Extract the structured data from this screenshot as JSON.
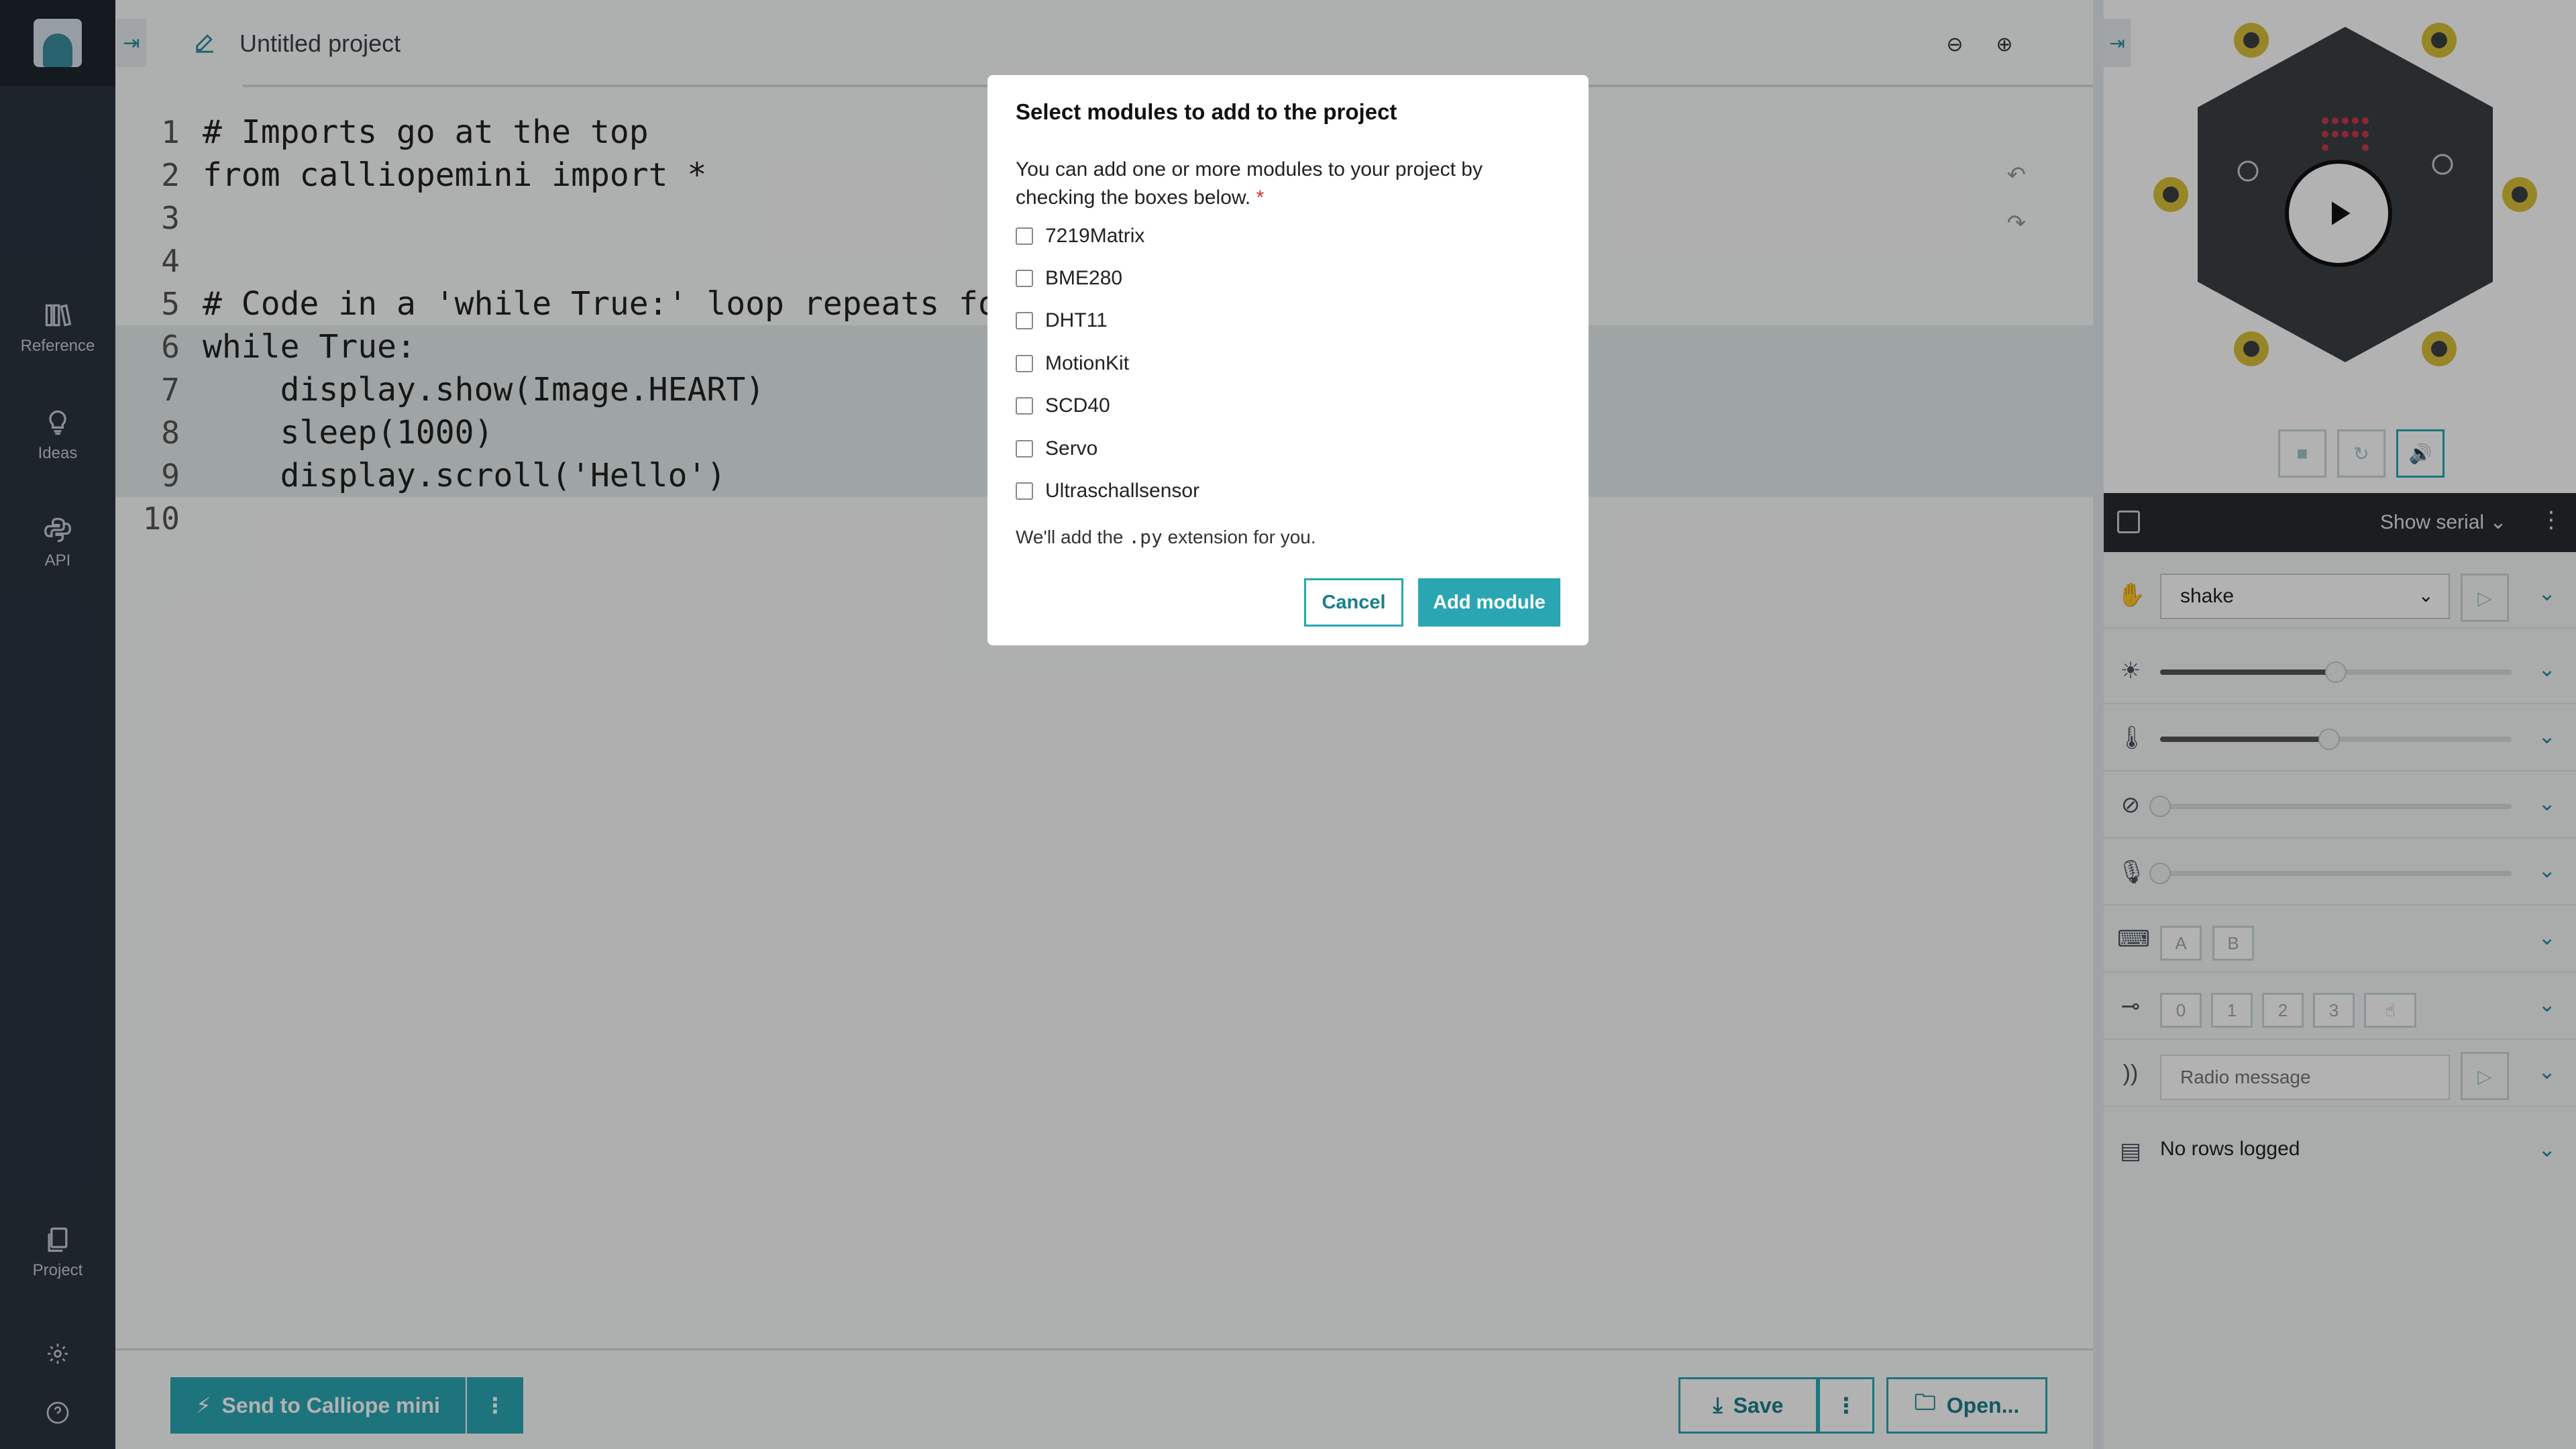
{
  "nav": {
    "items": [
      {
        "label": "Reference",
        "icon": "books-icon"
      },
      {
        "label": "Ideas",
        "icon": "lightbulb-icon"
      },
      {
        "label": "API",
        "icon": "python-icon"
      },
      {
        "label": "Project",
        "icon": "files-icon"
      }
    ],
    "settings_icon": "gear-icon",
    "help_icon": "help-icon"
  },
  "editor": {
    "project_name": "Untitled project",
    "lines": [
      {
        "num": "1",
        "text": "# Imports go at the top"
      },
      {
        "num": "2",
        "text": "from calliopemini import *"
      },
      {
        "num": "3",
        "text": ""
      },
      {
        "num": "4",
        "text": ""
      },
      {
        "num": "5",
        "text": "# Code in a 'while True:' loop repeats for"
      },
      {
        "num": "6",
        "text": "while True:"
      },
      {
        "num": "7",
        "text": "    display.show(Image.HEART)"
      },
      {
        "num": "8",
        "text": "    sleep(1000)"
      },
      {
        "num": "9",
        "text": "    display.scroll('Hello')"
      },
      {
        "num": "10",
        "text": ""
      }
    ]
  },
  "bottom": {
    "send_label": "Send to Calliope mini",
    "save_label": "Save",
    "open_label": "Open..."
  },
  "sim": {
    "serial_label": "Show serial",
    "gesture_value": "shake",
    "radio_placeholder": "Radio message",
    "buttons": [
      "A",
      "B"
    ],
    "pins": [
      "0",
      "1",
      "2",
      "3"
    ],
    "log_text": "No rows logged",
    "light_level": 0.5,
    "temperature_level": 0.48,
    "compass_level": 0.0,
    "sound_level": 0.0,
    "accent": "#2aa6b3"
  },
  "dialog": {
    "title": "Select modules to add to the project",
    "description": "You can add one or more modules to your project by checking the boxes below.",
    "required_mark": "*",
    "modules": [
      "7219Matrix",
      "BME280",
      "DHT11",
      "MotionKit",
      "SCD40",
      "Servo",
      "Ultraschallsensor"
    ],
    "ext_before": "We'll add the",
    "ext_code": ".py",
    "ext_after": "extension for you.",
    "cancel_label": "Cancel",
    "add_label": "Add module"
  }
}
